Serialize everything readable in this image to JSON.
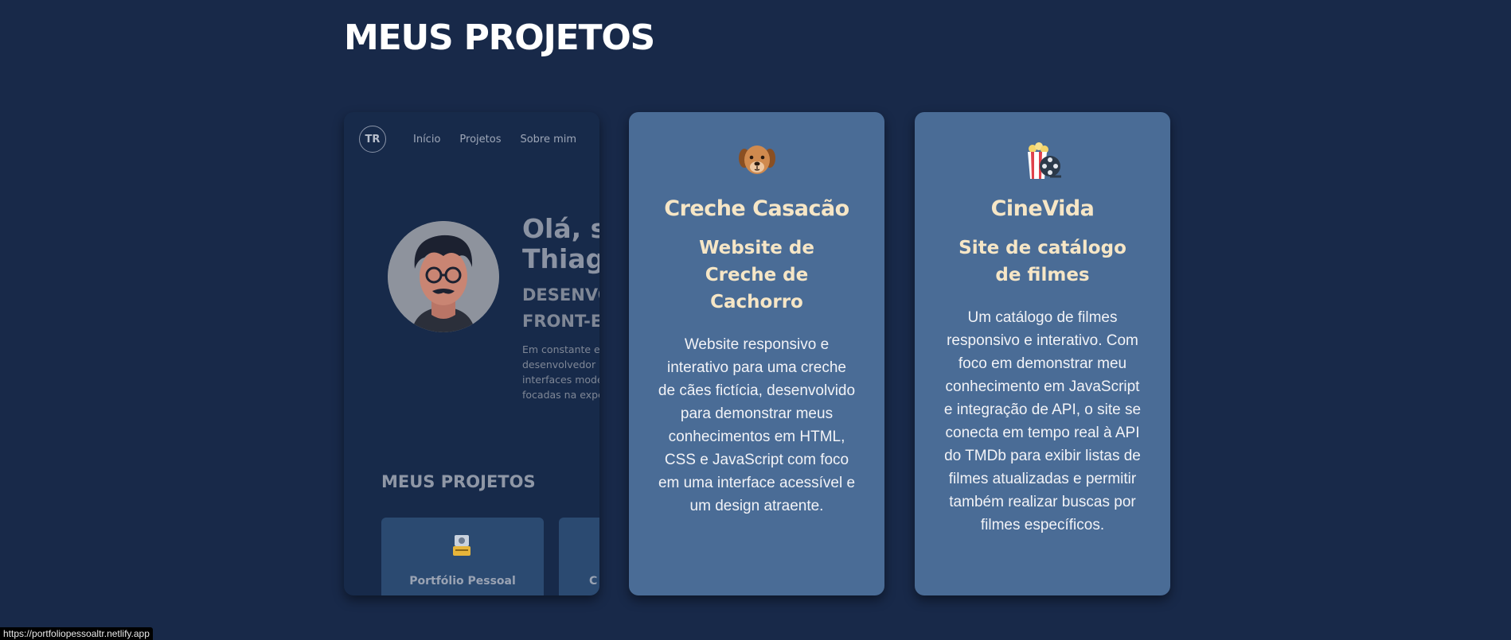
{
  "section_title": "MEUS PROJETOS",
  "preview": {
    "logo": "TR",
    "nav": [
      "Início",
      "Projetos",
      "Sobre mim"
    ],
    "greeting_lines": [
      "Olá, so",
      "Thiago"
    ],
    "role_lines": [
      "DESENVO",
      "FRONT-E"
    ],
    "desc_lines": [
      "Em constante ev",
      "desenvolvedor F",
      "interfaces mode",
      "focadas na expe"
    ],
    "projects_title": "MEUS PROJETOS",
    "mini_cards": [
      {
        "icon": "briefcase-icon",
        "label": "Portfólio Pessoal"
      },
      {
        "icon": "",
        "label": "C"
      }
    ]
  },
  "projects": [
    {
      "icon": "dog-icon",
      "name": "Creche Casacão",
      "subtitle": "Website de Creche de Cachorro",
      "description": "Website responsivo e interativo para uma creche de cães fictícia, desenvolvido para demonstrar meus conhecimentos em HTML, CSS e JavaScript com foco em uma interface acessível e um design atraente."
    },
    {
      "icon": "popcorn-film-icon",
      "name": "CineVida",
      "subtitle": "Site de catálogo de filmes",
      "description": "Um catálogo de filmes responsivo e interativo. Com foco em demonstrar meu conhecimento em JavaScript e integração de API, o site se conecta em tempo real à API do TMDb para exibir listas de filmes atualizadas e permitir também realizar buscas por filmes específicos."
    }
  ],
  "status_url": "https://portfoliopessoaltr.netlify.app",
  "colors": {
    "background": "#182949",
    "card": "#4a6c96",
    "card_title": "#f6e6c6",
    "text": "#f2f3f7"
  }
}
